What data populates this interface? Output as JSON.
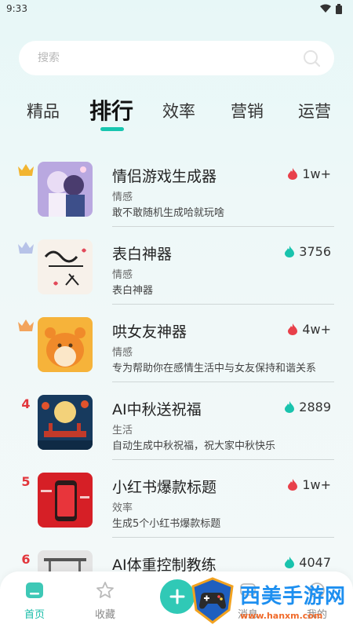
{
  "status": {
    "time": "9:33"
  },
  "search": {
    "placeholder": "搜索"
  },
  "tabs": [
    {
      "label": "精品"
    },
    {
      "label": "排行",
      "active": true
    },
    {
      "label": "效率"
    },
    {
      "label": "营销"
    },
    {
      "label": "运营"
    }
  ],
  "items": [
    {
      "rank": "1",
      "rank_badge": "gold-crown",
      "title": "情侣游戏生成器",
      "category": "情感",
      "description": "敢不敢随机生成哈就玩啥",
      "stat": "1w+",
      "stat_icon": "fire-icon",
      "stat_color": "#e8404a"
    },
    {
      "rank": "2",
      "rank_badge": "silver-crown",
      "title": "表白神器",
      "category": "情感",
      "description": "表白神器",
      "stat": "3756",
      "stat_icon": "flame-icon",
      "stat_color": "#19c3ad"
    },
    {
      "rank": "3",
      "rank_badge": "bronze-crown",
      "title": "哄女友神器",
      "category": "情感",
      "description": "专为帮助你在感情生活中与女友保持和谐关系",
      "stat": "4w+",
      "stat_icon": "fire-icon",
      "stat_color": "#e8404a"
    },
    {
      "rank": "4",
      "title": "AI中秋送祝福",
      "category": "生活",
      "description": "自动生成中秋祝福，祝大家中秋快乐",
      "stat": "2889",
      "stat_icon": "flame-icon",
      "stat_color": "#19c3ad"
    },
    {
      "rank": "5",
      "title": "小红书爆款标题",
      "category": "效率",
      "description": "生成5个小红书爆款标题",
      "stat": "1w+",
      "stat_icon": "fire-icon",
      "stat_color": "#e8404a"
    },
    {
      "rank": "6",
      "title": "AI体重控制教练",
      "category": "",
      "description": "",
      "stat": "4047",
      "stat_icon": "flame-icon",
      "stat_color": "#19c3ad"
    }
  ],
  "nav": {
    "home": "首页",
    "favorites": "收藏",
    "messages": "消息",
    "mine": "我的"
  },
  "watermark": {
    "title": "西美手游网",
    "url": "www.hanxm.com"
  },
  "colors": {
    "accent": "#18c6b0",
    "hot": "#e8404a"
  }
}
